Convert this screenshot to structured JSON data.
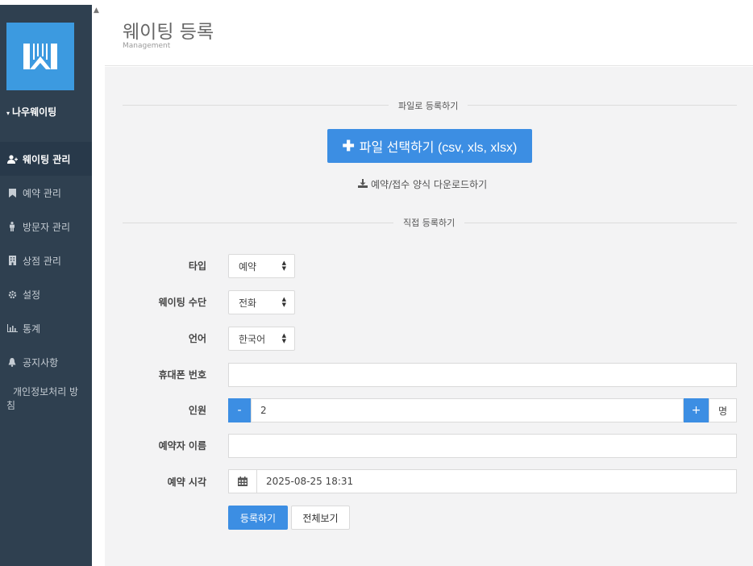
{
  "sidebar": {
    "brand": "나우웨이팅",
    "items": [
      {
        "label": "웨이팅 관리",
        "icon": "user-plus-icon",
        "active": true
      },
      {
        "label": "예약 관리",
        "icon": "bookmark-icon"
      },
      {
        "label": "방문자 관리",
        "icon": "male-icon"
      },
      {
        "label": "상점 관리",
        "icon": "building-icon"
      },
      {
        "label": "설정",
        "icon": "gear-icon"
      },
      {
        "label": "통계",
        "icon": "bar-chart-icon"
      },
      {
        "label": "공지사항",
        "icon": "bell-icon"
      },
      {
        "label": "개인정보처리 방침",
        "icon": ""
      }
    ]
  },
  "header": {
    "title": "웨이팅 등록",
    "subtitle": "Management"
  },
  "file_section": {
    "divider": "파일로 등록하기",
    "button": "파일 선택하기 (csv, xls, xlsx)",
    "download": "예약/접수 양식 다운로드하기"
  },
  "direct_section": {
    "divider": "직접 등록하기"
  },
  "form": {
    "type": {
      "label": "타입",
      "value": "예약"
    },
    "method": {
      "label": "웨이팅 수단",
      "value": "전화"
    },
    "language": {
      "label": "언어",
      "value": "한국어"
    },
    "phone": {
      "label": "휴대폰 번호",
      "value": ""
    },
    "people": {
      "label": "인원",
      "minus": "-",
      "value": "2",
      "plus": "+",
      "unit": "명"
    },
    "name": {
      "label": "예약자 이름",
      "value": ""
    },
    "time": {
      "label": "예약 시각",
      "value": "2025-08-25 18:31"
    }
  },
  "buttons": {
    "submit": "등록하기",
    "view_all": "전체보기"
  },
  "colors": {
    "sidebar": "#2f4050",
    "accent": "#3c8ee3",
    "logo": "#3c9ae0"
  }
}
